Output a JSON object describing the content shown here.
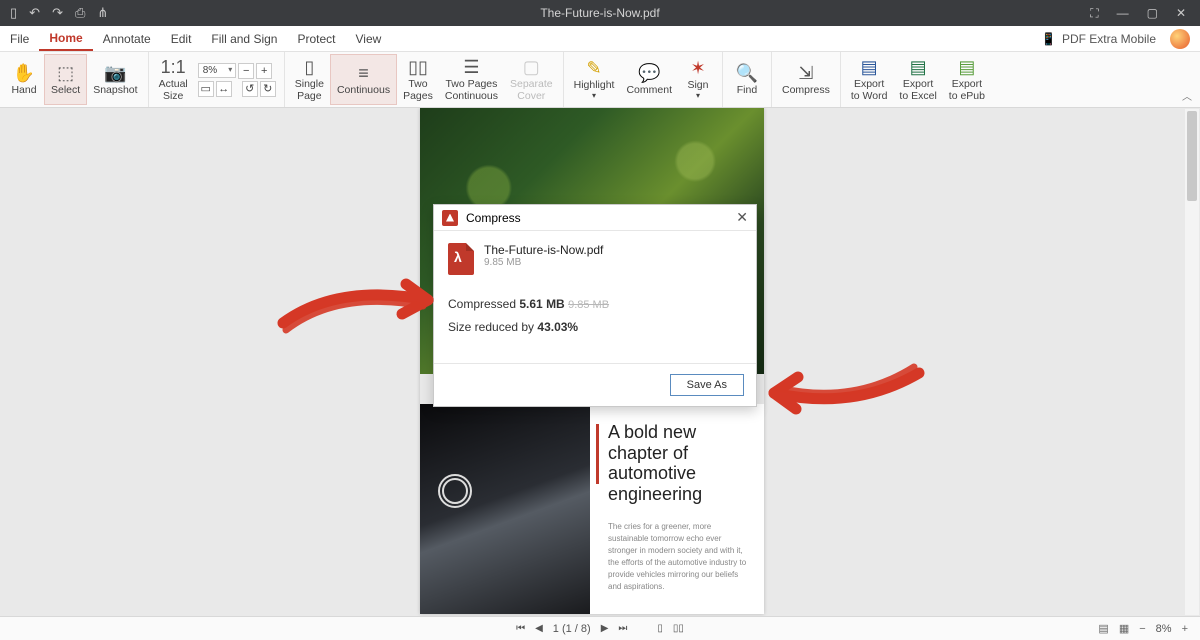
{
  "titlebar": {
    "title": "The-Future-is-Now.pdf"
  },
  "menu": {
    "items": [
      "File",
      "Home",
      "Annotate",
      "Edit",
      "Fill and Sign",
      "Protect",
      "View"
    ],
    "active_index": 1,
    "mobile_label": "PDF Extra Mobile"
  },
  "ribbon": {
    "hand": "Hand",
    "select": "Select",
    "snapshot": "Snapshot",
    "actual_size": "Actual\nSize",
    "zoom_value": "8%",
    "single_page": "Single\nPage",
    "continuous": "Continuous",
    "two_pages": "Two\nPages",
    "two_pages_cont": "Two Pages\nContinuous",
    "separate_cover": "Separate\nCover",
    "highlight": "Highlight",
    "comment": "Comment",
    "sign": "Sign",
    "find": "Find",
    "compress": "Compress",
    "export_word": "Export\nto Word",
    "export_excel": "Export\nto Excel",
    "export_epub": "Export\nto ePub"
  },
  "dialog": {
    "title": "Compress",
    "filename": "The-Future-is-Now.pdf",
    "filesize": "9.85 MB",
    "compressed_label": "Compressed",
    "compressed_value": "5.61 MB",
    "old_value": "9.85 MB",
    "reduced_label": "Size reduced by",
    "reduced_value": "43.03%",
    "save_as": "Save As"
  },
  "page_content": {
    "heading": "A bold new chapter of automotive engineering",
    "body": "The cries for a greener, more sustainable tomorrow echo ever stronger in modern society and with it, the efforts of the automotive industry to provide vehicles mirroring our beliefs and aspirations."
  },
  "status": {
    "page_display": "1 (1 / 8)",
    "zoom": "8%"
  }
}
